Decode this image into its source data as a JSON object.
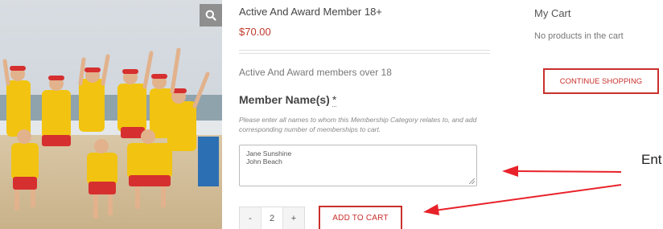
{
  "product": {
    "title": "Active And Award Member 18+",
    "price": "$70.00",
    "short_description": "Active And Award members over 18",
    "zoom_icon": "search-icon"
  },
  "member_field": {
    "label": "Member Name(s)",
    "required_mark": "*",
    "help": "Please enter all names to whom this Membership Category relates to, and add corresponding number of memberships to cart.",
    "value_lines": [
      "Jane Sunshine",
      "John Beach"
    ]
  },
  "quantity": {
    "minus_label": "-",
    "value": "2",
    "plus_label": "+"
  },
  "add_to_cart_label": "ADD TO CART",
  "cart": {
    "title": "My Cart",
    "empty_text": "No products in the cart",
    "continue_label": "CONTINUE SHOPPING"
  },
  "annotation": {
    "text": "Ent",
    "arrow_color": "#e8222a"
  },
  "colors": {
    "accent": "#c9302c",
    "price": "#c0392b"
  }
}
